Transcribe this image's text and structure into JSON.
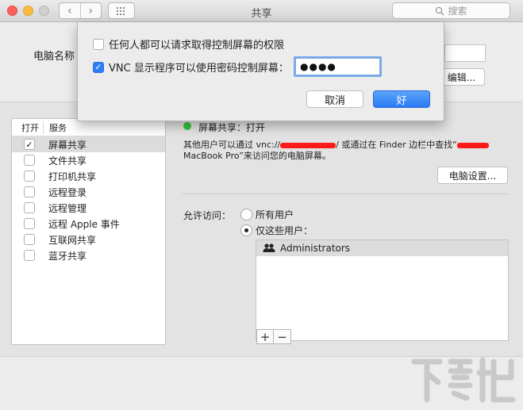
{
  "window": {
    "title": "共享",
    "nav_back": "‹",
    "nav_forward": "›",
    "search_placeholder": "搜索"
  },
  "top": {
    "computer_name_label": "电脑名称",
    "edit_button": "编辑..."
  },
  "sheet": {
    "option_anyone": "任何人都可以请求取得控制屏幕的权限",
    "option_anyone_checked": false,
    "option_vnc": "VNC 显示程序可以使用密码控制屏幕：",
    "option_vnc_checked": true,
    "password_value": "●●●●",
    "cancel_button": "取消",
    "ok_button": "好"
  },
  "service_list": {
    "header_on": "打开",
    "header_service": "服务",
    "items": [
      {
        "label": "屏幕共享",
        "checked": true,
        "selected": true
      },
      {
        "label": "文件共享",
        "checked": false,
        "selected": false
      },
      {
        "label": "打印机共享",
        "checked": false,
        "selected": false
      },
      {
        "label": "远程登录",
        "checked": false,
        "selected": false
      },
      {
        "label": "远程管理",
        "checked": false,
        "selected": false
      },
      {
        "label": "远程 Apple 事件",
        "checked": false,
        "selected": false
      },
      {
        "label": "互联网共享",
        "checked": false,
        "selected": false
      },
      {
        "label": "蓝牙共享",
        "checked": false,
        "selected": false
      }
    ]
  },
  "detail": {
    "status_text": "屏幕共享：打开",
    "status_color": "#37c63c",
    "info_part1": "其他用户可以通过 vnc://",
    "info_part2": "/ 或通过在 Finder 边栏中查找“",
    "info_part3": "MacBook Pro”来访问您的电脑屏幕。",
    "settings_button": "电脑设置...",
    "access_label": "允许访问：",
    "radio_all_users": "所有用户",
    "radio_only_users": "仅这些用户：",
    "radio_selected": "only_users",
    "users": [
      "Administrators"
    ],
    "add_button": "+",
    "remove_button": "−"
  },
  "watermark": {
    "text": "下载吧"
  },
  "colors": {
    "accent": "#2b7cf6",
    "redaction": "#ff1a1a"
  }
}
